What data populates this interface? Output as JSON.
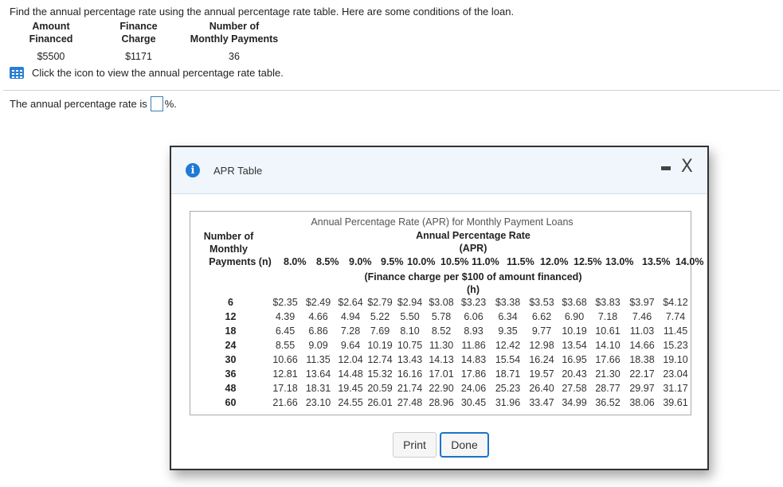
{
  "question": {
    "text": "Find the annual percentage rate using the annual percentage rate table. Here are some conditions of the loan.",
    "conditions": [
      {
        "label1": "Amount",
        "label2": "Financed",
        "value": "$5500"
      },
      {
        "label1": "Finance",
        "label2": "Charge",
        "value": "$1171"
      },
      {
        "label1": "Number of",
        "label2": "Monthly Payments",
        "value": "36"
      }
    ],
    "icon_text": "Click the icon to view the annual percentage rate table.",
    "answer_prefix": "The annual percentage rate is",
    "answer_value": "",
    "answer_suffix": "%."
  },
  "modal": {
    "title": "APR Table",
    "icons": {
      "info": "info-icon",
      "minimize": "minimize-icon",
      "close": "close-icon"
    },
    "close_glyph": "X",
    "info_glyph": "i",
    "table_title": "Annual Percentage Rate (APR) for Monthly Payment Loans",
    "row_header": [
      "Number of",
      "Monthly",
      "Payments (n)"
    ],
    "apr_header": [
      "Annual Percentage Rate",
      "(APR)"
    ],
    "sub_header": [
      "(Finance charge per $100 of amount financed)",
      "(h)"
    ],
    "rates": [
      "8.0%",
      "8.5%",
      "9.0%",
      "9.5%",
      "10.0%",
      "10.5%",
      "11.0%",
      "11.5%",
      "12.0%",
      "12.5%",
      "13.0%",
      "13.5%",
      "14.0%"
    ],
    "rows": [
      {
        "n": "6",
        "values": [
          "$2.35",
          "$2.49",
          "$2.64",
          "$2.79",
          "$2.94",
          "$3.08",
          "$3.23",
          "$3.38",
          "$3.53",
          "$3.68",
          "$3.83",
          "$3.97",
          "$4.12"
        ]
      },
      {
        "n": "12",
        "values": [
          "4.39",
          "4.66",
          "4.94",
          "5.22",
          "5.50",
          "5.78",
          "6.06",
          "6.34",
          "6.62",
          "6.90",
          "7.18",
          "7.46",
          "7.74"
        ]
      },
      {
        "n": "18",
        "values": [
          "6.45",
          "6.86",
          "7.28",
          "7.69",
          "8.10",
          "8.52",
          "8.93",
          "9.35",
          "9.77",
          "10.19",
          "10.61",
          "11.03",
          "11.45"
        ]
      },
      {
        "n": "24",
        "values": [
          "8.55",
          "9.09",
          "9.64",
          "10.19",
          "10.75",
          "11.30",
          "11.86",
          "12.42",
          "12.98",
          "13.54",
          "14.10",
          "14.66",
          "15.23"
        ]
      },
      {
        "n": "30",
        "values": [
          "10.66",
          "11.35",
          "12.04",
          "12.74",
          "13.43",
          "14.13",
          "14.83",
          "15.54",
          "16.24",
          "16.95",
          "17.66",
          "18.38",
          "19.10"
        ]
      },
      {
        "n": "36",
        "values": [
          "12.81",
          "13.64",
          "14.48",
          "15.32",
          "16.16",
          "17.01",
          "17.86",
          "18.71",
          "19.57",
          "20.43",
          "21.30",
          "22.17",
          "23.04"
        ]
      },
      {
        "n": "48",
        "values": [
          "17.18",
          "18.31",
          "19.45",
          "20.59",
          "21.74",
          "22.90",
          "24.06",
          "25.23",
          "26.40",
          "27.58",
          "28.77",
          "29.97",
          "31.17"
        ]
      },
      {
        "n": "60",
        "values": [
          "21.66",
          "23.10",
          "24.55",
          "26.01",
          "27.48",
          "28.96",
          "30.45",
          "31.96",
          "33.47",
          "34.99",
          "36.52",
          "38.06",
          "39.61"
        ]
      }
    ],
    "buttons": {
      "print": "Print",
      "done": "Done"
    }
  }
}
